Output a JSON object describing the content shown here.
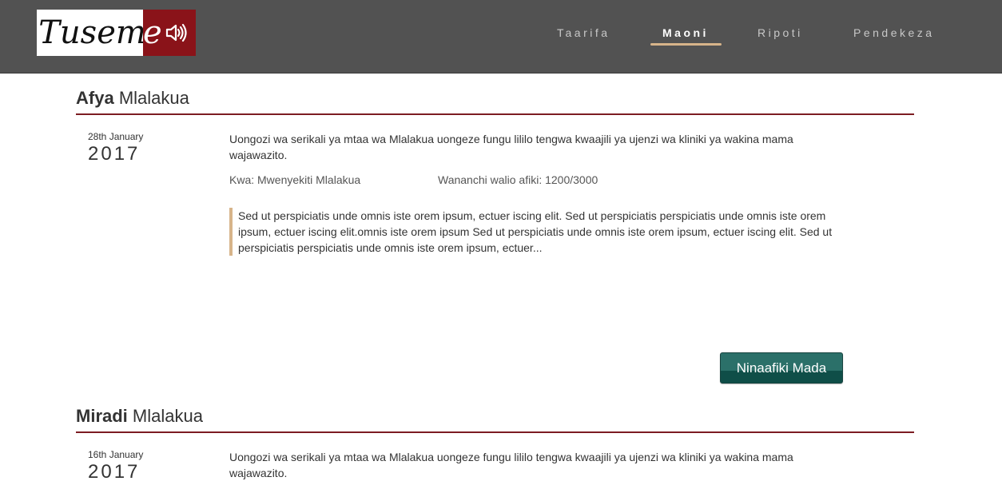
{
  "header": {
    "logo": {
      "text": "Tuseme",
      "icon": "speaker-icon"
    },
    "nav": [
      {
        "label": "Taarifa",
        "active": false
      },
      {
        "label": "Maoni",
        "active": true
      },
      {
        "label": "Ripoti",
        "active": false
      },
      {
        "label": "Pendekeza",
        "active": false
      }
    ]
  },
  "posts": [
    {
      "category_bold": "Afya",
      "category_rest": "Mlalakua",
      "date_day": "28th January",
      "date_year": "2017",
      "text": "Uongozi wa serikali ya mtaa wa Mlalakua uongeze fungu lililo tengwa kwaajili ya ujenzi wa kliniki ya wakina mama wajawazito.",
      "author": "Kwa: Mwenyekiti Mlalakua",
      "agreements": "Wananchi walio afiki: 1200/3000",
      "quote": "Sed ut perspiciatis unde omnis iste orem ipsum, ectuer iscing elit. Sed ut perspiciatis perspiciatis unde omnis iste orem ipsum, ectuer iscing elit.omnis iste orem ipsum Sed ut perspiciatis unde omnis iste orem ipsum, ectuer iscing elit. Sed ut perspiciatis perspiciatis unde omnis iste orem ipsum, ectuer...",
      "button_label": "Ninaafiki Mada"
    },
    {
      "category_bold": "Miradi",
      "category_rest": "Mlalakua",
      "date_day": "16th January",
      "date_year": "2017",
      "text": "Uongozi wa serikali ya mtaa wa Mlalakua uongeze fungu lililo tengwa kwaajili ya ujenzi wa kliniki ya wakina mama wajawazito."
    }
  ],
  "colors": {
    "header_bg": "#525252",
    "brand_red": "#8a1319",
    "accent_tan": "#d7b48a",
    "button_teal": "#2b7069",
    "rule_red": "#7c1c22"
  }
}
